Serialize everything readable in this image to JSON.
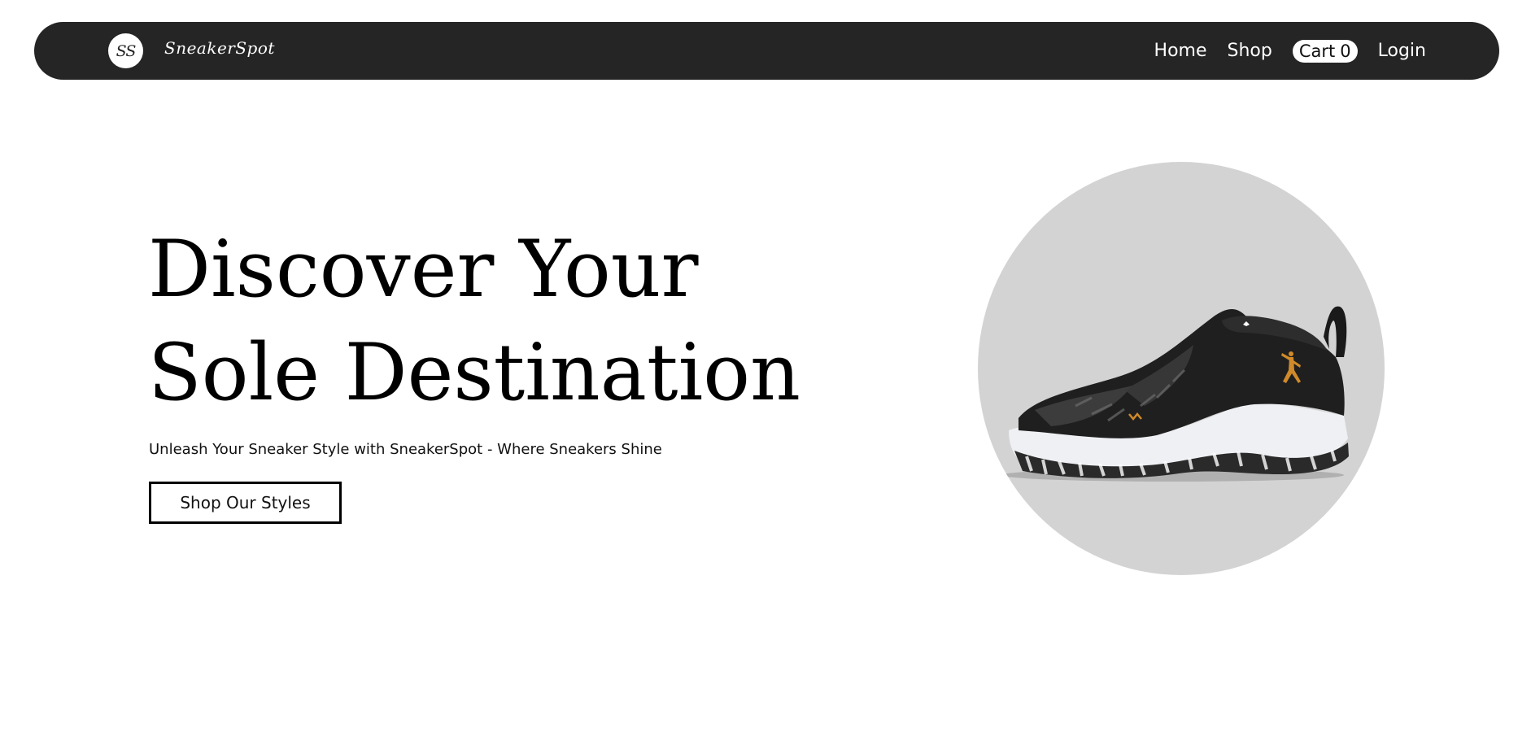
{
  "navbar": {
    "logo_monogram": "SS",
    "brand_name": "SneakerSpot",
    "links": {
      "home": "Home",
      "shop": "Shop",
      "cart_label": "Cart",
      "cart_count": "0",
      "login": "Login"
    },
    "background_color": "#252525"
  },
  "hero": {
    "title_line1": "Discover Your",
    "title_line2": "Sole Destination",
    "subtitle": "Unleash Your Sneaker Style with SneakerSpot - Where Sneakers Shine",
    "cta_label": "Shop Our Styles"
  },
  "product_image": {
    "icon": "sneaker-image",
    "circle_color": "#d3d3d3",
    "accent_color": "#d08a2a"
  }
}
